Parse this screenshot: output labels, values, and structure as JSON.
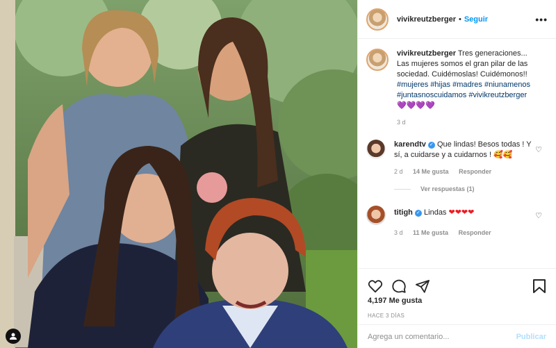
{
  "post": {
    "username": "vivikreutzberger",
    "follow_label": "Seguir",
    "dot": "•",
    "more": "•••"
  },
  "caption": {
    "username": "vivikreutzberger",
    "text": "Tres generaciones... Las mujeres somos el gran pilar de las sociedad. Cuidémoslas! Cuidémonos!!",
    "hashtags": [
      "#mujeres",
      "#hijas",
      "#madres",
      "#niunamenos",
      "#juntasnoscuidamos",
      "#vivikreutzberger"
    ],
    "emoji": "💜💜💜💜",
    "time": "3 d"
  },
  "comments": [
    {
      "username": "karendtv",
      "verified": true,
      "text": "Que lindas! Besos todas ! Y sí, a cuidarse y a cuidarnos ! 🥰🥰",
      "time": "2 d",
      "likes": "14 Me gusta",
      "reply_label": "Responder",
      "view_replies": "Ver respuestas (1)"
    },
    {
      "username": "titigh",
      "verified": true,
      "text": "Lindas",
      "emoji": "❤❤❤❤",
      "time": "3 d",
      "likes": "11 Me gusta",
      "reply_label": "Responder"
    }
  ],
  "actions": {
    "likes": "4,197 Me gusta",
    "ago": "HACE 3 DÍAS"
  },
  "add_comment": {
    "placeholder": "Agrega un comentario...",
    "publish_label": "Publicar"
  },
  "colors": {
    "link": "#0095f6",
    "hashtag": "#00376b",
    "muted": "#8e8e8e",
    "publish_disabled": "#b2dffc"
  }
}
